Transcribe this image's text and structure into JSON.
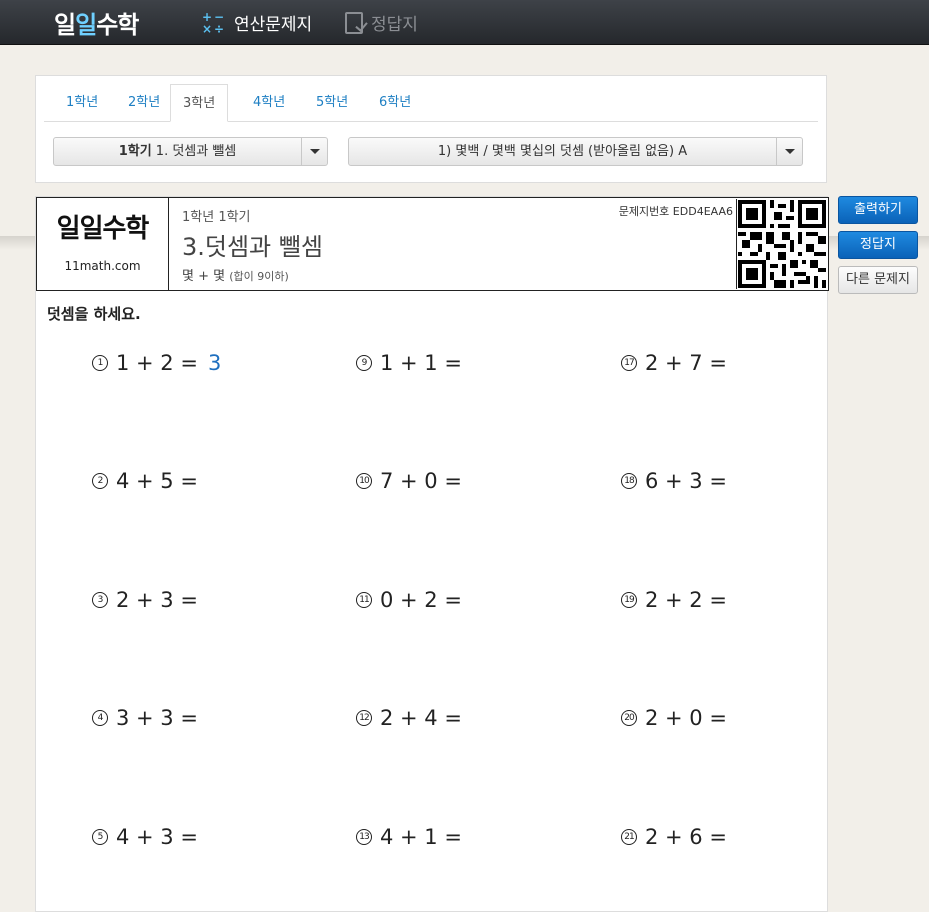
{
  "brand": {
    "logo_pre": "일",
    "logo_one": "일",
    "logo_post": "수학"
  },
  "nav": {
    "worksheet_label": "연산문제지",
    "answer_label": "정답지"
  },
  "grade_tabs": [
    "1학년",
    "2학년",
    "3학년",
    "4학년",
    "5학년",
    "6학년"
  ],
  "selected_grade_index": 2,
  "semester_select": {
    "bold": "1학기",
    "rest": " 1. 덧셈과 뺄셈"
  },
  "topic_select": "1) 몇백 / 몇백 몇십의 덧셈 (받아올림 없음) A",
  "sheet": {
    "logo": "일일수학",
    "site": "11math.com",
    "grade": "1학년 1학기",
    "unit": "3.덧셈과 뺄셈",
    "topic_main": "몇 + 몇",
    "topic_note": "(합이 9이하)",
    "code": "문제지번호 EDD4EAA6",
    "instruction": "덧셈을 하세요."
  },
  "problems": {
    "p1": {
      "num": "1",
      "expr": "1 + 2 =",
      "answer": "3"
    },
    "p2": {
      "num": "2",
      "expr": "4 + 5 ="
    },
    "p3": {
      "num": "3",
      "expr": "2 + 3 ="
    },
    "p4": {
      "num": "4",
      "expr": "3 + 3 ="
    },
    "p5": {
      "num": "5",
      "expr": "4 + 3 ="
    },
    "p9": {
      "num": "9",
      "expr": "1 + 1 ="
    },
    "p10": {
      "num": "10",
      "expr": "7 + 0 ="
    },
    "p11": {
      "num": "11",
      "expr": "0 + 2 ="
    },
    "p12": {
      "num": "12",
      "expr": "2 + 4 ="
    },
    "p13": {
      "num": "13",
      "expr": "4 + 1 ="
    },
    "p17": {
      "num": "17",
      "expr": "2 + 7 ="
    },
    "p18": {
      "num": "18",
      "expr": "6 + 3 ="
    },
    "p19": {
      "num": "19",
      "expr": "2 + 2 ="
    },
    "p20": {
      "num": "20",
      "expr": "2 + 0 ="
    },
    "p21": {
      "num": "21",
      "expr": "2 + 6 ="
    }
  },
  "side_buttons": {
    "print": "출력하기",
    "answers": "정답지",
    "other": "다른 문제지"
  }
}
